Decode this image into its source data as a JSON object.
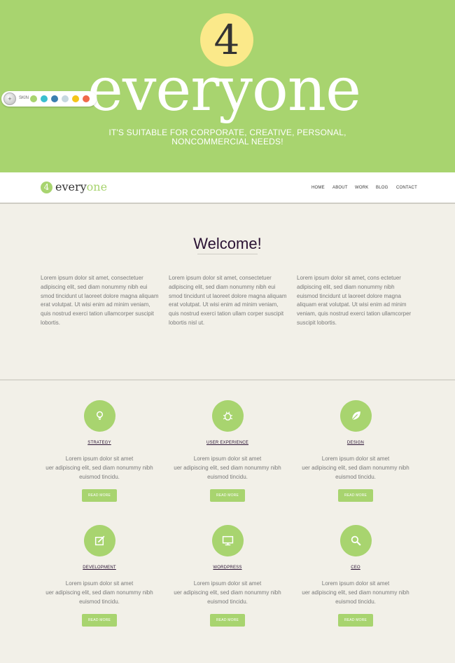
{
  "hero": {
    "badge": "4",
    "title": "everyone",
    "subtitle_line1": "IT'S SUITABLE FOR CORPORATE, CREATIVE, PERSONAL,",
    "subtitle_line2": "NONCOMMERCIAL NEEDS!"
  },
  "skin": {
    "button_icon": "+",
    "label": "SKIN",
    "swatches": [
      "#a8d46f",
      "#3bbfcf",
      "#3b7fb0",
      "#c6d8e0",
      "#f5c518",
      "#f06a4a"
    ]
  },
  "nav": {
    "logo_badge": "4",
    "logo_part1": "every",
    "logo_part2": "one",
    "items": [
      "HOME",
      "ABOUT",
      "WORK",
      "BLOG",
      "CONTACT"
    ]
  },
  "welcome": {
    "title": "Welcome!",
    "columns": [
      "Lorem ipsum dolor sit amet, consectetuer adipiscing elit, sed diam nonummy nibh eui smod tincidunt ut laoreet dolore magna aliquam erat volutpat. Ut wisi enim ad minim veniam, quis nostrud exerci tation ullamcorper suscipit lobortis.",
      "Lorem ipsum dolor sit amet, consectetuer adipiscing elit, sed diam nonummy nibh eui smod tincidunt ut laoreet dolore magna aliquam erat volutpat. Ut wisi enim ad minim veniam, quis nostrud exerci tation ullam corper suscipit lobortis nisl ut.",
      "Lorem ipsum dolor sit amet, cons ectetuer adipiscing elit, sed diam nonummy nibh euismod tincidunt ut laoreet dolore magna aliquam erat volutpat. Ut wisi enim ad minim veniam, quis nostrud exerci tation ullamcorper suscipit lobortis."
    ]
  },
  "services": [
    {
      "title": "STRATEGY",
      "icon": "lightbulb-icon",
      "line1": "Lorem ipsum dolor sit amet",
      "line2": "uer adipiscing elit, sed diam nonummy nibh",
      "line3": "euismod tincidu.",
      "button": "READ MORE"
    },
    {
      "title": "USER EXPERIENCE",
      "icon": "bug-icon",
      "line1": "Lorem ipsum dolor sit amet",
      "line2": "uer adipiscing elit, sed diam nonummy nibh",
      "line3": "euismod tincidu.",
      "button": "READ MORE"
    },
    {
      "title": "DESIGN",
      "icon": "leaf-icon",
      "line1": "Lorem ipsum dolor sit amet",
      "line2": "uer adipiscing elit, sed diam nonummy nibh",
      "line3": "euismod tincidu.",
      "button": "READ MORE"
    },
    {
      "title": "DEVELOPMENT",
      "icon": "edit-icon",
      "line1": "Lorem ipsum dolor sit amet",
      "line2": "uer adipiscing elit, sed diam nonummy nibh",
      "line3": "euismod tincidu.",
      "button": "READ MORE"
    },
    {
      "title": "WORDPRESS",
      "icon": "monitor-icon",
      "line1": "Lorem ipsum dolor sit amet",
      "line2": "uer adipiscing elit, sed diam nonummy nibh",
      "line3": "euismod tincidu.",
      "button": "READ MORE"
    },
    {
      "title": "CEO",
      "icon": "search-icon",
      "line1": "Lorem ipsum dolor sit amet",
      "line2": "uer adipiscing elit, sed diam nonummy nibh",
      "line3": "euismod tincidu.",
      "button": "READ MORE"
    }
  ],
  "colors": {
    "accent": "#a8d46f",
    "badge": "#fbe98a",
    "background": "#f2f0e8",
    "heading": "#2a1233"
  }
}
